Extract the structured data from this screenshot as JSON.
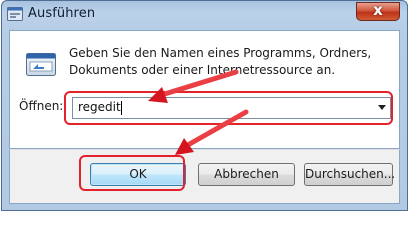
{
  "window": {
    "title": "Ausführen",
    "close_symbol": "x"
  },
  "dialog": {
    "description": "Geben Sie den Namen eines Programms, Ordners, Dokuments oder einer Internetressource an.",
    "open_label": "Öffnen:",
    "open_value": "regedit"
  },
  "buttons": {
    "ok": "OK",
    "cancel": "Abbrechen",
    "browse": "Durchsuchen..."
  },
  "annotations": {
    "highlight_color": "#e4222c"
  },
  "icons": {
    "title": "run-dialog-icon",
    "main": "run-program-icon",
    "close": "close-icon",
    "dropdown": "chevron-down-icon"
  }
}
